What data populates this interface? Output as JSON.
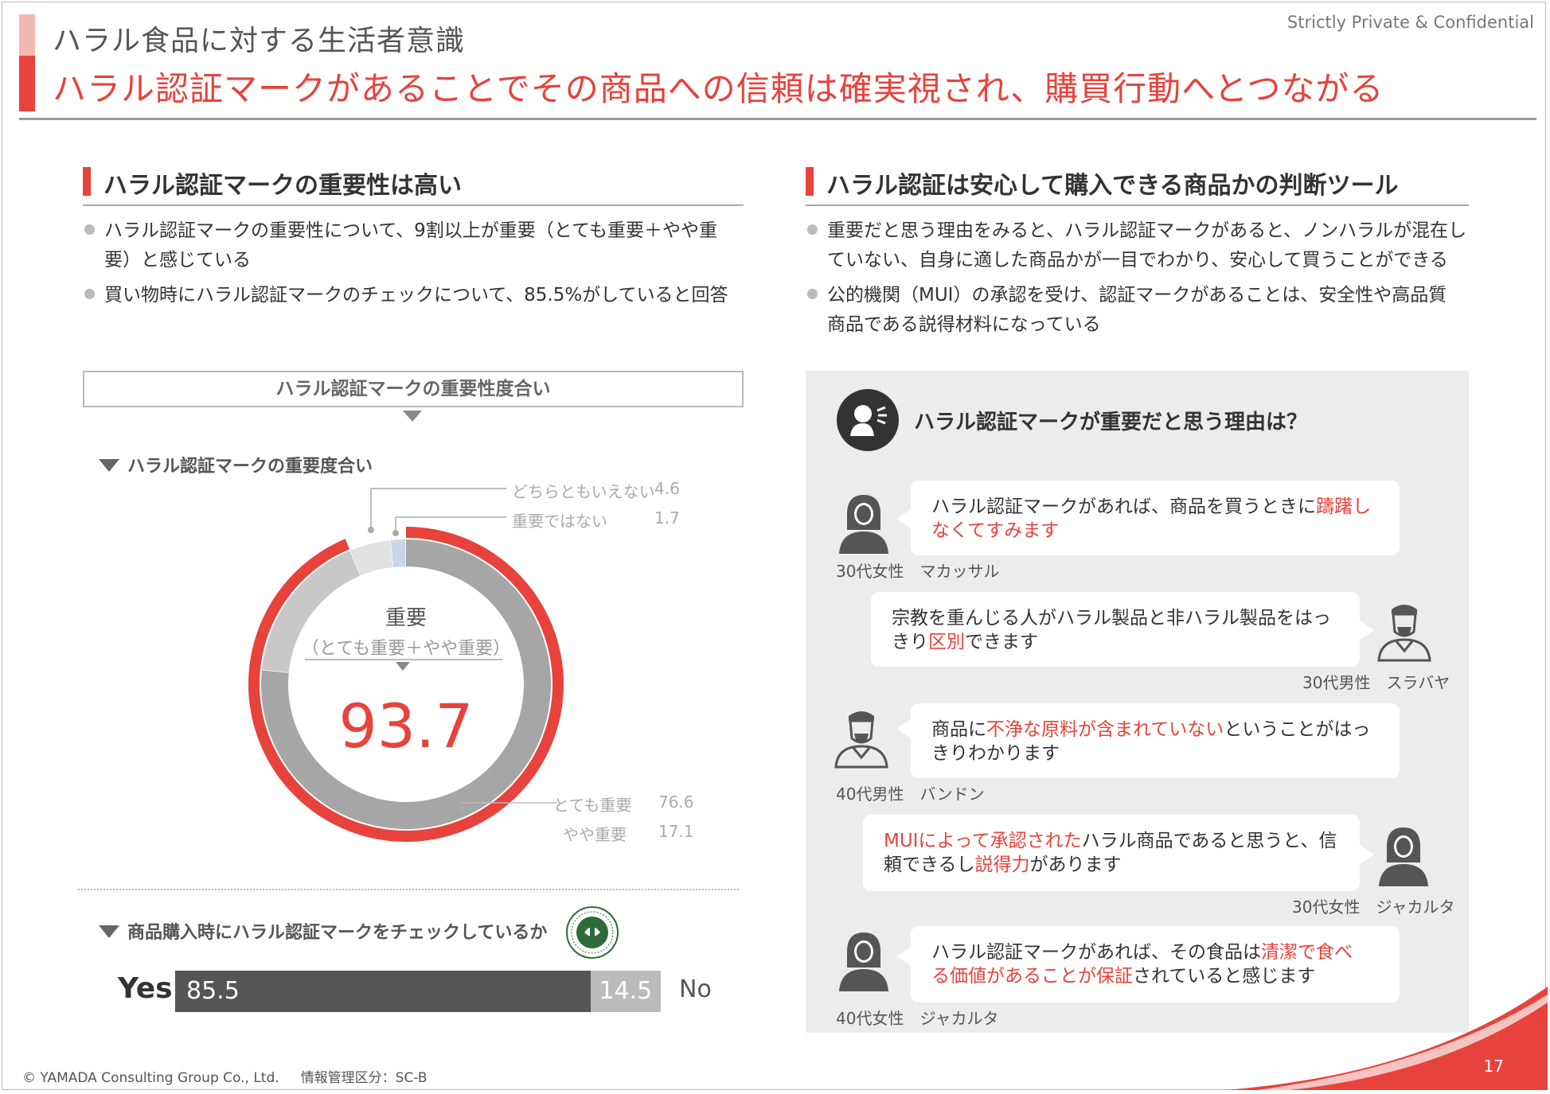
{
  "header": {
    "subtitle": "ハラル食品に対する生活者意識",
    "title": "ハラル認証マークがあることでその商品への信頼は確実視され、購買行動へとつながる",
    "confidential": "Strictly Private & Confidential"
  },
  "left": {
    "heading": "ハラル認証マークの重要性は高い",
    "bullets": [
      {
        "line1": "ハラル認証マークの重要性について、9割以上が重要（とても重要＋やや重",
        "line2": "要）と感じている"
      },
      {
        "line1": "買い物時にハラル認証マークのチェックについて、85.5%がしていると回答"
      }
    ],
    "box_title": "ハラル認証マークの重要性度合い",
    "chart1_title": "ハラル認証マークの重要度合い",
    "center_label": "重要",
    "center_sub": "（とても重要＋やや重要）",
    "center_value": "93.7",
    "chart2_title": "商品購入時にハラル認証マークをチェックしているか",
    "logo_text": "MAJELIS ULAMA INDONESIA"
  },
  "chart_data": [
    {
      "type": "pie",
      "title": "ハラル認証マークの重要度合い",
      "categories": [
        "とても重要",
        "やや重要",
        "どちらともいえない",
        "重要ではない"
      ],
      "values": [
        76.6,
        17.1,
        4.6,
        1.7
      ],
      "value_labels": [
        "76.6",
        "17.1",
        "4.6",
        "1.7"
      ],
      "colors": [
        "#a6a6a6",
        "#c8c8c8",
        "#e2e2e2",
        "#c9d6e3"
      ],
      "highlight": {
        "label": "重要",
        "sublabel": "（とても重要＋やや重要）",
        "value": 93.7,
        "color": "#e8423c"
      }
    },
    {
      "type": "bar",
      "title": "商品購入時にハラル認証マークをチェックしているか",
      "categories": [
        "Yes",
        "No"
      ],
      "values": [
        85.5,
        14.5
      ],
      "value_labels": [
        "85.5",
        "14.5"
      ],
      "colors": [
        "#555555",
        "#bbbbbb"
      ]
    }
  ],
  "right": {
    "heading": "ハラル認証は安心して購入できる商品かの判断ツール",
    "bullets": [
      {
        "line1": "重要だと思う理由をみると、ハラル認証マークがあると、ノンハラルが混在し",
        "line2": "ていない、自身に適した商品かが一目でわかり、安心して買うことができる"
      },
      {
        "line1": "公的機関（MUI）の承認を受け、認証マークがあることは、安全性や高品質",
        "line2": "商品である説得材料になっている"
      }
    ],
    "panel_title": "ハラル認証マークが重要だと思う理由は？",
    "quotes": [
      {
        "l1a": "ハラル認証マークがあれば、商品を買うときに",
        "l1h": "躊躇し",
        "l2h": "なくてすみます",
        "l2a": "",
        "who": "30代女性　マカッサル"
      },
      {
        "l1a": "宗教を重んじる人がハラル製品と非ハラル製品をはっ",
        "l2a": "きり",
        "l2h": "区別",
        "l2b": "できます",
        "who": "30代男性　スラバヤ"
      },
      {
        "l1a": "商品に",
        "l1h": "不浄な原料が含まれていない",
        "l1b": "ということがはっ",
        "l2a": "きりわかります",
        "who": "40代男性　バンドン"
      },
      {
        "l1h": "MUIによって承認された",
        "l1b": "ハラル商品であると思うと、信",
        "l2a": "頼できるし",
        "l2h": "説得力",
        "l2b": "があります",
        "who": "30代女性　ジャカルタ"
      },
      {
        "l1a": "ハラル認証マークがあれば、その食品は",
        "l1h": "清潔で食べ",
        "l2h": "る価値があることが保証",
        "l2b": "されていると感じます",
        "who": "40代女性　ジャカルタ"
      }
    ]
  },
  "footer": {
    "copyright": "© YAMADA Consulting Group Co., Ltd.",
    "classification": "情報管理区分：SC-B",
    "page": "17"
  }
}
